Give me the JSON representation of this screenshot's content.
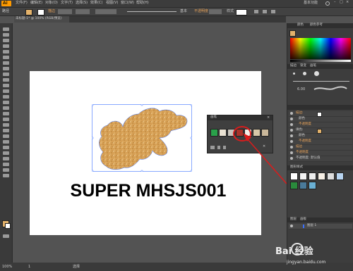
{
  "app": {
    "logo": "Ai"
  },
  "menu": [
    "文件(F)",
    "编辑(E)",
    "对象(O)",
    "文字(T)",
    "选择(S)",
    "效果(C)",
    "视图(V)",
    "窗口(W)",
    "帮助(H)"
  ],
  "workspace": "基本功能",
  "control_bar": {
    "mode": "路径",
    "stroke_label": "描边",
    "stroke_style": "基本",
    "opacity_label": "不透明度",
    "style_label": "样式"
  },
  "document_tab": "未标题-1* @ 100% (RGB/预览)",
  "canvas": {
    "text": "SUPER MHSJS001"
  },
  "panels": {
    "color": {
      "tabs": [
        "颜色",
        "颜色参考"
      ]
    },
    "brush": {
      "tabs": [
        "描边",
        "渐变",
        "画笔"
      ],
      "stroke_weight": "6.00"
    },
    "appearance": {
      "items": [
        "描边:",
        "颜色",
        "不透明度",
        "填色:",
        "颜色",
        "不透明度",
        "描边",
        "不透明度",
        "不透明度: 默认值"
      ]
    },
    "graphic_styles": {
      "title": "图形样式"
    },
    "layers": {
      "tabs": [
        "图层",
        "画板"
      ],
      "layer_name": "图层 1"
    }
  },
  "swatch_popup": {
    "title": "画笔"
  },
  "status": {
    "zoom": "100%",
    "page": "1",
    "tool_name": "选择"
  },
  "watermark": {
    "text": "Bai 经验",
    "url": "jingyan.baidu.com"
  },
  "colors": {
    "accent": "#ff9a00",
    "highlight": "#d91c1c",
    "selection": "#3a70ff"
  }
}
